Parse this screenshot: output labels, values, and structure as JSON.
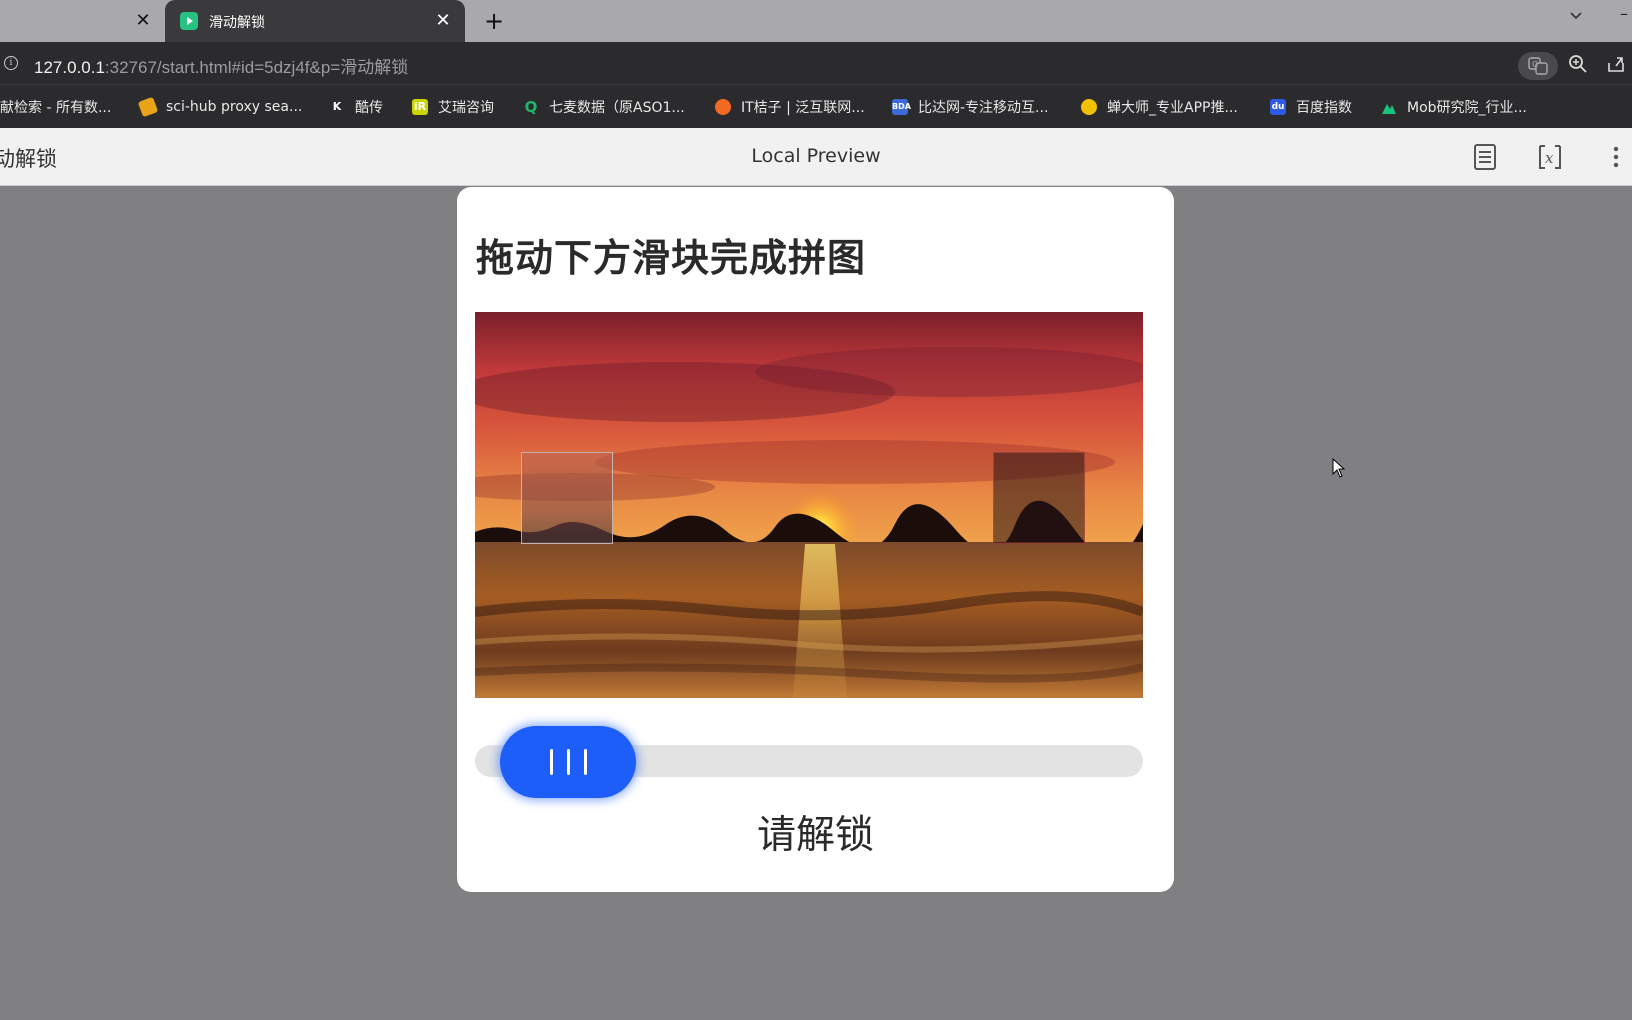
{
  "browser": {
    "tabs": [
      {
        "title": "",
        "active": false
      },
      {
        "title": "滑动解锁",
        "active": true
      }
    ],
    "url": {
      "host": "127.0.0.1",
      "rest": ":32767/start.html#id=5dzj4f&p=滑动解锁"
    },
    "bookmarks": [
      {
        "label": "献检索 - 所有数...",
        "icon": "doc-search-icon",
        "color": "#6b6b6b"
      },
      {
        "label": "sci-hub proxy sea...",
        "icon": "scihub-icon",
        "color": "#e8a317"
      },
      {
        "label": "酷传",
        "icon": "k-icon",
        "color": "#2b2b2e"
      },
      {
        "label": "艾瑞咨询",
        "icon": "ir-icon",
        "color": "#c9d400"
      },
      {
        "label": "七麦数据（原ASO1...",
        "icon": "q-icon",
        "color": "#1fb86b"
      },
      {
        "label": "IT桔子 | 泛互联网...",
        "icon": "orange-icon",
        "color": "#f26a22"
      },
      {
        "label": "比达网-专注移动互...",
        "icon": "bda-icon",
        "color": "#3c6bd8"
      },
      {
        "label": "蝉大师_专业APP推...",
        "icon": "cicada-icon",
        "color": "#f2c200"
      },
      {
        "label": "百度指数",
        "icon": "baidu-icon",
        "color": "#2f5ae6"
      },
      {
        "label": "Mob研究院_行业...",
        "icon": "mob-icon",
        "color": "#19c27d"
      }
    ]
  },
  "preview": {
    "left_title": "动解锁",
    "title": "Local Preview"
  },
  "card": {
    "title": "拖动下方滑块完成拼图",
    "status": "请解锁",
    "slider_progress": 0.04
  },
  "colors": {
    "accent": "#1e5ef8",
    "track": "#e3e3e4",
    "page_bg": "#808083"
  }
}
